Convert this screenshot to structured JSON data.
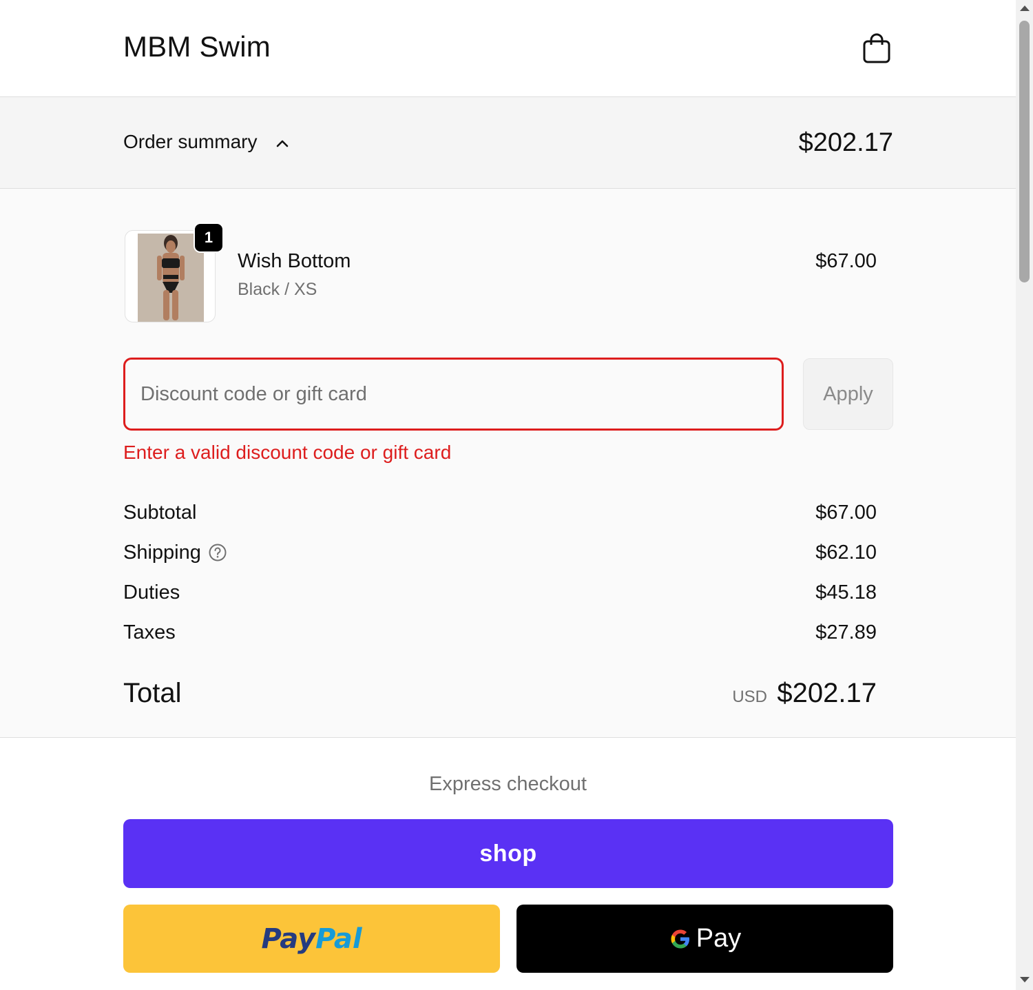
{
  "header": {
    "brand": "MBM Swim",
    "cart_icon": "shopping-bag-icon"
  },
  "summary": {
    "label": "Order summary",
    "toggle_icon": "chevron-up-icon",
    "total": "$202.17"
  },
  "cart": {
    "items": [
      {
        "quantity": "1",
        "name": "Wish Bottom",
        "variant": "Black / XS",
        "price": "$67.00"
      }
    ]
  },
  "discount": {
    "placeholder": "Discount code or gift card",
    "value": "",
    "apply_label": "Apply",
    "error": "Enter a valid discount code or gift card",
    "error_color": "#dd1d1d"
  },
  "totals": {
    "lines": [
      {
        "label": "Subtotal",
        "value": "$67.00"
      },
      {
        "label": "Shipping",
        "value": "$62.10"
      },
      {
        "label": "Duties",
        "value": "$45.18"
      },
      {
        "label": "Taxes",
        "value": "$27.89"
      }
    ],
    "total_label": "Total",
    "currency": "USD",
    "total_value": "$202.17"
  },
  "express": {
    "title": "Express checkout",
    "shop_label": "shop",
    "shop_color": "#5a31f4",
    "paypal_label_pay": "Pay",
    "paypal_label_pal": "Pal",
    "paypal_color": "#fcc439",
    "gpay_label": "Pay",
    "gpay_color": "#000000"
  }
}
